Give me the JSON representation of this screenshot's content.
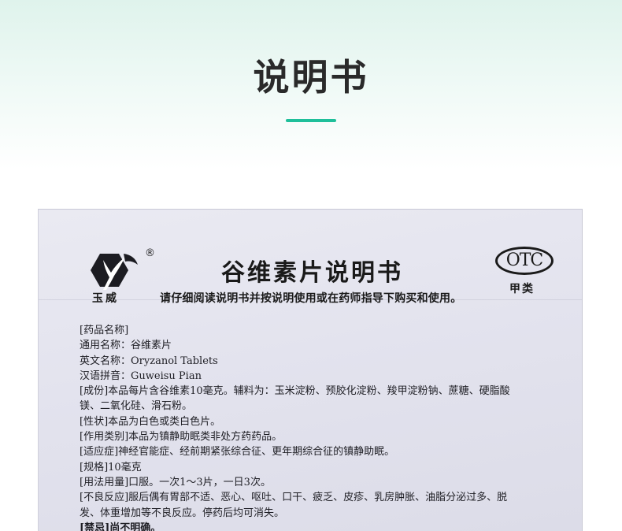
{
  "header": {
    "title": "说明书"
  },
  "leaflet": {
    "brand_name": "玉威",
    "registered_mark": "®",
    "doc_title": "谷维素片说明书",
    "otc_badge": "OTC",
    "otc_category": "甲类",
    "instruction": "请仔细阅读说明书并按说明使用或在药师指导下购买和使用。",
    "lines": [
      "[药品名称]",
      "通用名称：谷维素片",
      "英文名称：Oryzanol Tablets",
      "汉语拼音：Guweisu Pian",
      "[成份]本品每片含谷维素10毫克。辅料为：玉米淀粉、预胶化淀粉、羧甲淀粉钠、蔗糖、硬脂酸",
      "镁、二氧化硅、滑石粉。",
      "[性状]本品为白色或类白色片。",
      "[作用类别]本品为镇静助眠类非处方药药品。",
      "[适应症]神经官能症、经前期紧张综合征、更年期综合征的镇静助眠。",
      "[规格]10毫克",
      "[用法用量]口服。一次1～3片，一日3次。",
      "[不良反应]服后偶有胃部不适、恶心、呕吐、口干、疲乏、皮疹、乳房肿胀、油脂分泌过多、脱",
      "发、体重增加等不良反应。停药后均可消失。",
      "[禁忌]尚不明确。"
    ]
  },
  "colors": {
    "accent": "#1fbf9a",
    "title_text": "#2a2a2a",
    "paper": "#e3e3ee"
  },
  "icons": {
    "brand_logo": "brand-logo-icon"
  }
}
